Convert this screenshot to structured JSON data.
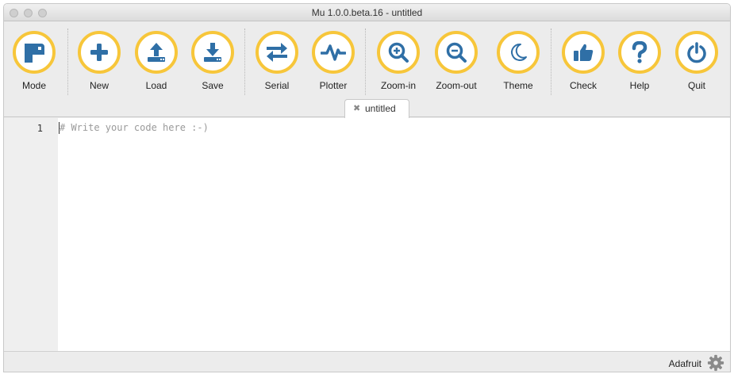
{
  "window": {
    "title": "Mu 1.0.0.beta.16 - untitled"
  },
  "toolbar": {
    "accent_color": "#f7c63a",
    "icon_color": "#2f6fa6",
    "buttons": [
      {
        "id": "mode",
        "label": "Mode",
        "icon": "mode-icon"
      },
      {
        "id": "new",
        "label": "New",
        "icon": "plus-icon"
      },
      {
        "id": "load",
        "label": "Load",
        "icon": "upload-icon"
      },
      {
        "id": "save",
        "label": "Save",
        "icon": "download-icon"
      },
      {
        "id": "serial",
        "label": "Serial",
        "icon": "swap-arrows-icon"
      },
      {
        "id": "plotter",
        "label": "Plotter",
        "icon": "pulse-icon"
      },
      {
        "id": "zoom-in",
        "label": "Zoom-in",
        "icon": "zoom-in-icon"
      },
      {
        "id": "zoom-out",
        "label": "Zoom-out",
        "icon": "zoom-out-icon"
      },
      {
        "id": "theme",
        "label": "Theme",
        "icon": "moon-icon"
      },
      {
        "id": "check",
        "label": "Check",
        "icon": "thumbs-up-icon"
      },
      {
        "id": "help",
        "label": "Help",
        "icon": "question-icon"
      },
      {
        "id": "quit",
        "label": "Quit",
        "icon": "power-icon"
      }
    ]
  },
  "tabs": [
    {
      "label": "untitled",
      "close": "✖",
      "active": true
    }
  ],
  "editor": {
    "lines": [
      {
        "number": "1",
        "text": "# Write your code here :-)"
      }
    ]
  },
  "status": {
    "mode": "Adafruit",
    "icon": "gear-icon"
  }
}
